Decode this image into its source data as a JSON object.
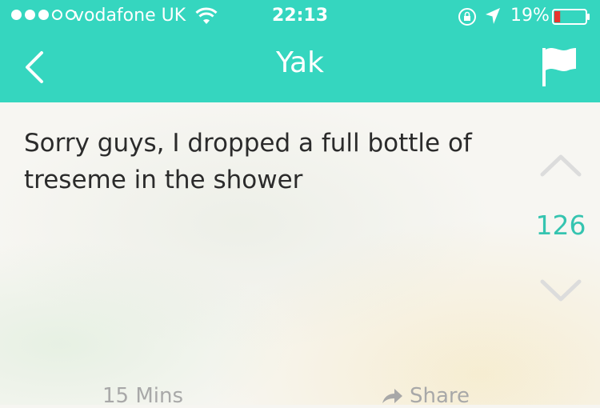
{
  "status_bar": {
    "carrier": "vodafone UK",
    "time": "22:13",
    "battery_percent": "19%",
    "battery_level": 0.19,
    "signal_bars_filled": 3,
    "signal_bars_total": 5,
    "icons": [
      "wifi-icon",
      "rotation-lock-icon",
      "location-arrow-icon",
      "battery-icon"
    ]
  },
  "nav": {
    "title": "Yak",
    "back_icon": "back-chevron-icon",
    "flag_icon": "flag-icon"
  },
  "post": {
    "text": "Sorry guys, I dropped a full bottle of treseme in the shower",
    "votes": "126",
    "age": "15 Mins",
    "share_label": "Share"
  },
  "colors": {
    "accent": "#35d6bf",
    "vote_count": "#35c4b0",
    "battery_low": "#e8342e"
  }
}
